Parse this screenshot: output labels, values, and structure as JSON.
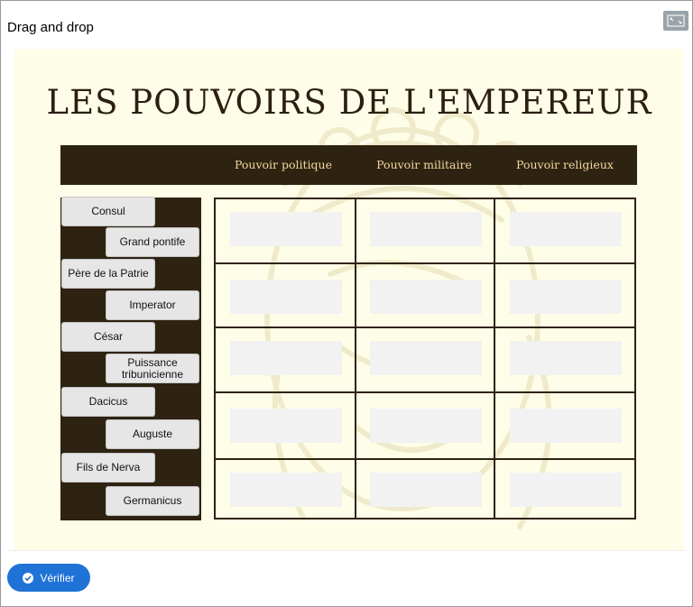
{
  "app": {
    "title": "Drag and drop",
    "fullscreen_icon": "fullscreen-icon"
  },
  "activity": {
    "heading": "LES POUVOIRS DE L'EMPEREUR",
    "columns": [
      "Pouvoir politique",
      "Pouvoir militaire",
      "Pouvoir religieux"
    ],
    "draggables": [
      "Consul",
      "Grand pontife",
      "Père de la Patrie",
      "Imperator",
      "César",
      "Puissance tribunicienne",
      "Dacicus",
      "Auguste",
      "Fils de Nerva",
      "Germanicus"
    ],
    "rows": 5,
    "colors": {
      "dark": "#2e2311",
      "header_text": "#f2d79e",
      "background": "#fefde8"
    }
  },
  "footer": {
    "verify_label": "Vérifier",
    "verify_icon": "check-circle-icon",
    "accent": "#1f73d6"
  }
}
